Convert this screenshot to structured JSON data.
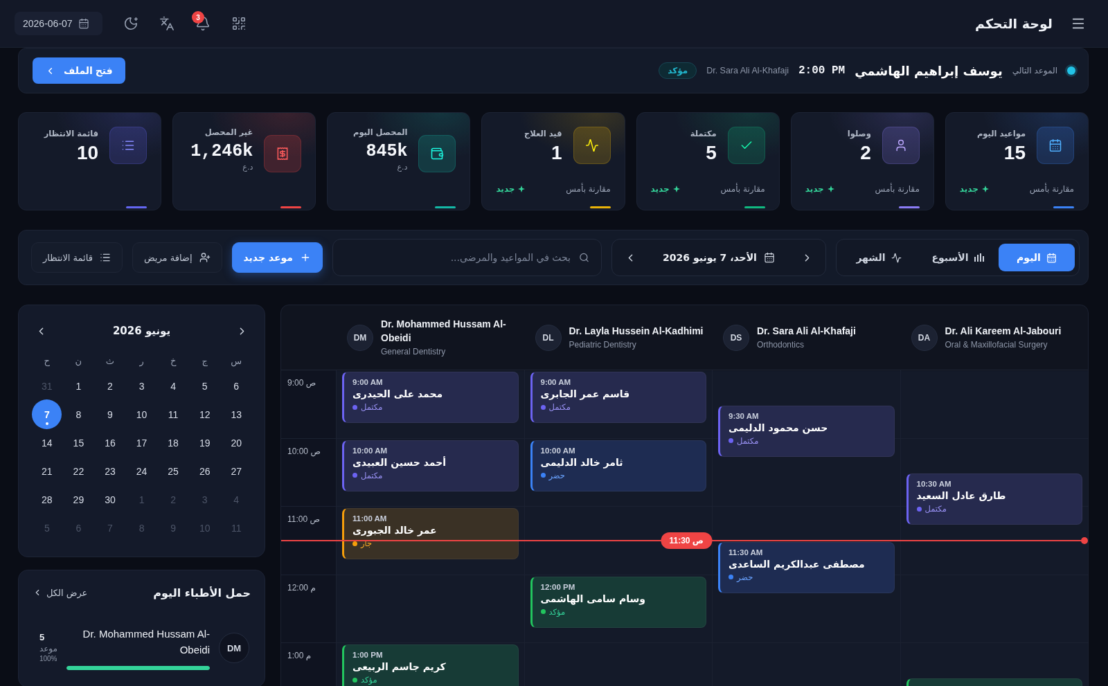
{
  "top_bar": {
    "title": "لوحة التحكم",
    "date": "2026-06-07",
    "notifications_badge": "3"
  },
  "next_appointment": {
    "label": "الموعد التالي",
    "patient": "يوسف إبراهيم الهاشمي",
    "time": "2:00 PM",
    "doctor": "Dr. Sara Ali Al-Khafaji",
    "status": "مؤكد",
    "button": "فتح الملف"
  },
  "stats": [
    {
      "kind": "calendar",
      "label": "مواعيد اليوم",
      "value": "15",
      "color": "#3b82f6",
      "comparison": "مقارنة بأمس",
      "trend": "جديد"
    },
    {
      "kind": "arrived",
      "label": "وصلوا",
      "value": "2",
      "color": "#8b7cf6",
      "comparison": "مقارنة بأمس",
      "trend": "جديد"
    },
    {
      "kind": "completed",
      "label": "مكتملة",
      "value": "5",
      "color": "#10b981",
      "comparison": "مقارنة بأمس",
      "trend": "جديد"
    },
    {
      "kind": "in_treatment",
      "label": "قيد العلاج",
      "value": "1",
      "color": "#eab308",
      "comparison": "مقارنة بأمس",
      "trend": "جديد"
    },
    {
      "kind": "collected",
      "label": "المحصل اليوم",
      "value": "845k",
      "unit": "د.ع",
      "color": "#14b8a6"
    },
    {
      "kind": "uncollected",
      "label": "غير المحصل",
      "value": "1,246k",
      "unit": "د.ع",
      "color": "#ef4444"
    },
    {
      "kind": "waitlist",
      "label": "قائمة الانتظار",
      "value": "10",
      "color": "#6366f1"
    }
  ],
  "toolbar": {
    "views": [
      {
        "kind": "day",
        "label": "اليوم",
        "selected": true
      },
      {
        "kind": "week",
        "label": "الأسبوع",
        "selected": false
      },
      {
        "kind": "month",
        "label": "الشهر",
        "selected": false
      }
    ],
    "date": "الأحد، 7 يونيو 2026",
    "search": {
      "placeholder": "بحث في المواعيد والمرضى..."
    },
    "actions": [
      {
        "kind": "new",
        "label": "موعد جديد"
      },
      {
        "kind": "add_patient",
        "label": "إضافة مريض"
      },
      {
        "kind": "waitlist",
        "label": "قائمة الانتظار"
      }
    ]
  },
  "mini_calendar": {
    "title": "يونيو 2026",
    "weekdays": [
      "س",
      "ج",
      "خ",
      "ر",
      "ث",
      "ن",
      "ح"
    ],
    "weeks": [
      [
        {
          "day": "6",
          "outside": false,
          "selected": false,
          "dot": false
        },
        {
          "day": "5",
          "outside": false,
          "selected": false,
          "dot": false
        },
        {
          "day": "4",
          "outside": false,
          "selected": false,
          "dot": false
        },
        {
          "day": "3",
          "outside": false,
          "selected": false,
          "dot": false
        },
        {
          "day": "2",
          "outside": false,
          "selected": false,
          "dot": false
        },
        {
          "day": "1",
          "outside": false,
          "selected": false,
          "dot": false
        },
        {
          "day": "31",
          "outside": true,
          "selected": false,
          "dot": false
        }
      ],
      [
        {
          "day": "13",
          "outside": false,
          "selected": false,
          "dot": false
        },
        {
          "day": "12",
          "outside": false,
          "selected": false,
          "dot": false
        },
        {
          "day": "11",
          "outside": false,
          "selected": false,
          "dot": false
        },
        {
          "day": "10",
          "outside": false,
          "selected": false,
          "dot": false
        },
        {
          "day": "9",
          "outside": false,
          "selected": false,
          "dot": false
        },
        {
          "day": "8",
          "outside": false,
          "selected": false,
          "dot": false
        },
        {
          "day": "7",
          "outside": false,
          "selected": true,
          "dot": true
        }
      ],
      [
        {
          "day": "20",
          "outside": false,
          "selected": false,
          "dot": false
        },
        {
          "day": "19",
          "outside": false,
          "selected": false,
          "dot": false
        },
        {
          "day": "18",
          "outside": false,
          "selected": false,
          "dot": false
        },
        {
          "day": "17",
          "outside": false,
          "selected": false,
          "dot": false
        },
        {
          "day": "16",
          "outside": false,
          "selected": false,
          "dot": false
        },
        {
          "day": "15",
          "outside": false,
          "selected": false,
          "dot": false
        },
        {
          "day": "14",
          "outside": false,
          "selected": false,
          "dot": false
        }
      ],
      [
        {
          "day": "27",
          "outside": false,
          "selected": false,
          "dot": false
        },
        {
          "day": "26",
          "outside": false,
          "selected": false,
          "dot": false
        },
        {
          "day": "25",
          "outside": false,
          "selected": false,
          "dot": false
        },
        {
          "day": "24",
          "outside": false,
          "selected": false,
          "dot": false
        },
        {
          "day": "23",
          "outside": false,
          "selected": false,
          "dot": false
        },
        {
          "day": "22",
          "outside": false,
          "selected": false,
          "dot": false
        },
        {
          "day": "21",
          "outside": false,
          "selected": false,
          "dot": false
        }
      ],
      [
        {
          "day": "4",
          "outside": true,
          "selected": false,
          "dot": false
        },
        {
          "day": "3",
          "outside": true,
          "selected": false,
          "dot": false
        },
        {
          "day": "2",
          "outside": true,
          "selected": false,
          "dot": false
        },
        {
          "day": "1",
          "outside": true,
          "selected": false,
          "dot": false
        },
        {
          "day": "30",
          "outside": false,
          "selected": false,
          "dot": false
        },
        {
          "day": "29",
          "outside": false,
          "selected": false,
          "dot": false
        },
        {
          "day": "28",
          "outside": false,
          "selected": false,
          "dot": false
        }
      ],
      [
        {
          "day": "11",
          "outside": true,
          "selected": false,
          "dot": false
        },
        {
          "day": "10",
          "outside": true,
          "selected": false,
          "dot": false
        },
        {
          "day": "9",
          "outside": true,
          "selected": false,
          "dot": false
        },
        {
          "day": "8",
          "outside": true,
          "selected": false,
          "dot": false
        },
        {
          "day": "7",
          "outside": true,
          "selected": false,
          "dot": false
        },
        {
          "day": "6",
          "outside": true,
          "selected": false,
          "dot": false
        },
        {
          "day": "5",
          "outside": true,
          "selected": false,
          "dot": false
        }
      ]
    ]
  },
  "doctor_load": {
    "title": "حمل الأطباء اليوم",
    "view_all": "عرض الكل",
    "doctors": [
      {
        "initials": "DM",
        "name": "Dr. Mohammed Hussam Al-Obeidi",
        "count": "5",
        "unit": "موعد",
        "percent": "100%",
        "level": 1
      }
    ]
  },
  "schedule": {
    "doctors": [
      {
        "initials": "DA",
        "name": "Dr. Ali Kareem Al-Jabouri",
        "specialty": "Oral & Maxillofacial Surgery"
      },
      {
        "initials": "DS",
        "name": "Dr. Sara Ali Al-Khafaji",
        "specialty": "Orthodontics"
      },
      {
        "initials": "DL",
        "name": "Dr. Layla Hussein Al-Kadhimi",
        "specialty": "Pediatric Dentistry"
      },
      {
        "initials": "DM",
        "name": "Dr. Mohammed Hussam Al-Obeidi",
        "specialty": "General Dentistry"
      }
    ],
    "rows": [
      {
        "cells": [
          {
            "kind": "free"
          },
          {
            "kind": "completed",
            "half_hour": true,
            "time": "9:30 AM",
            "patient": "حسن محمود الدليمى",
            "status": "مكتمل"
          },
          {
            "kind": "completed",
            "half_hour": false,
            "time": "9:00 AM",
            "patient": "قاسم عمر الجابرى",
            "status": "مكتمل"
          },
          {
            "kind": "completed",
            "half_hour": false,
            "time": "9:00 AM",
            "patient": "محمد على الحيدرى",
            "status": "مكتمل"
          }
        ],
        "time": "9:00 ص"
      },
      {
        "cells": [
          {
            "kind": "completed",
            "half_hour": true,
            "time": "10:30 AM",
            "patient": "طارق عادل السعيد",
            "status": "مكتمل"
          },
          {
            "kind": "free"
          },
          {
            "kind": "arrived",
            "half_hour": false,
            "time": "10:00 AM",
            "patient": "ثامر خالد الدليمى",
            "status": "حضر"
          },
          {
            "kind": "completed",
            "half_hour": false,
            "time": "10:00 AM",
            "patient": "أحمد حسين العبيدى",
            "status": "مكتمل"
          }
        ],
        "time": "10:00 ص"
      },
      {
        "cells": [
          {
            "kind": "free"
          },
          {
            "kind": "arrived",
            "half_hour": true,
            "time": "11:30 AM",
            "patient": "مصطفى عبدالكريم الساعدى",
            "status": "حضر"
          },
          {
            "kind": "free"
          },
          {
            "kind": "in_progress",
            "half_hour": false,
            "time": "11:00 AM",
            "patient": "عمر خالد الجبورى",
            "status": "جار"
          }
        ],
        "time": "11:00 ص",
        "now": {
          "label": "11:30 ص",
          "half_hour": true
        }
      },
      {
        "cells": [
          {
            "kind": "free"
          },
          {
            "kind": "free"
          },
          {
            "kind": "confirmed",
            "half_hour": false,
            "time": "12:00 PM",
            "patient": "وسام سامى الهاشمى",
            "status": "مؤكد"
          },
          {
            "kind": "free"
          }
        ],
        "time": "12:00 م"
      },
      {
        "cells": [
          {
            "kind": "confirmed",
            "half_hour": true
          },
          {
            "kind": "free"
          },
          {
            "kind": "free"
          },
          {
            "kind": "confirmed",
            "half_hour": false,
            "time": "1:00 PM",
            "patient": "كريم جاسم الربيعى",
            "status": "مؤكد"
          }
        ],
        "time": "1:00 م"
      }
    ]
  }
}
